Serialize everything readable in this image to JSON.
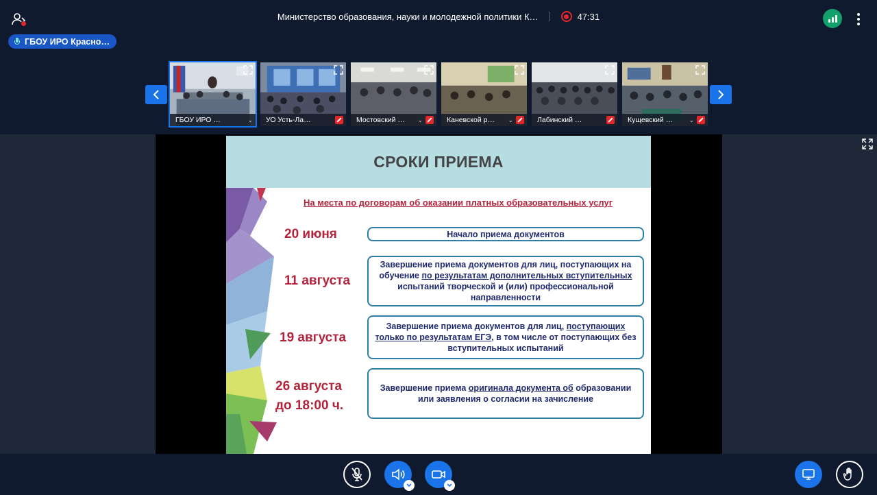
{
  "app": {
    "conference_title": "Министерство образования, науки и молодежной политики К…",
    "timer": "47:31",
    "speaker_label": "ГБОУ ИРО Красно…"
  },
  "thumbnails": [
    {
      "name": "ГБОУ ИРО …",
      "active": true
    },
    {
      "name": "УО Усть-Ла…",
      "active": false
    },
    {
      "name": "Мостовский …",
      "active": false
    },
    {
      "name": "Каневской р…",
      "active": false
    },
    {
      "name": "Лабинский …",
      "active": false
    },
    {
      "name": "Кущевский …",
      "active": false
    }
  ],
  "slide": {
    "title": "СРОКИ ПРИЕМА",
    "subtitle": "На места по договорам об оказании платных образовательных услуг",
    "rows": [
      {
        "date": "20 июня",
        "text_parts": [
          {
            "t": "Начало приема документов",
            "u": false
          }
        ]
      },
      {
        "date": "11 августа",
        "text_parts": [
          {
            "t": "Завершение приема документов для лиц, поступающих на обучение ",
            "u": false
          },
          {
            "t": "по результатам дополнительных вступительных",
            "u": true
          },
          {
            "t": " испытаний творческой и (или) профессиональной направленности",
            "u": false
          }
        ]
      },
      {
        "date": "19 августа",
        "text_parts": [
          {
            "t": "Завершение приема документов для лиц, ",
            "u": false
          },
          {
            "t": "поступающих только по результатам ЕГЭ",
            "u": true
          },
          {
            "t": ", в том числе от поступающих без вступительных испытаний",
            "u": false
          }
        ]
      },
      {
        "date_lines": [
          "26 августа",
          "до 18:00 ч."
        ],
        "text_parts": [
          {
            "t": "Завершение приема ",
            "u": false
          },
          {
            "t": "оригинала документа об",
            "u": true
          },
          {
            "t": " образовании или заявления о согласии на зачисление",
            "u": false
          }
        ]
      }
    ]
  },
  "icons": {
    "participants": "participants-icon",
    "record": "record-icon",
    "signal": "signal-icon",
    "more": "more-vertical-icon",
    "mic_off": "mic-off-icon",
    "speaker": "speaker-icon",
    "camera": "camera-icon",
    "screen": "screen-share-icon",
    "hand": "raise-hand-icon"
  },
  "colors": {
    "accent": "#1a73e8",
    "record": "#e5262b",
    "signal": "#12a06b",
    "slide_date": "#b3243c",
    "slide_box_border": "#2e7fa8",
    "slide_header": "#b5dde2"
  }
}
